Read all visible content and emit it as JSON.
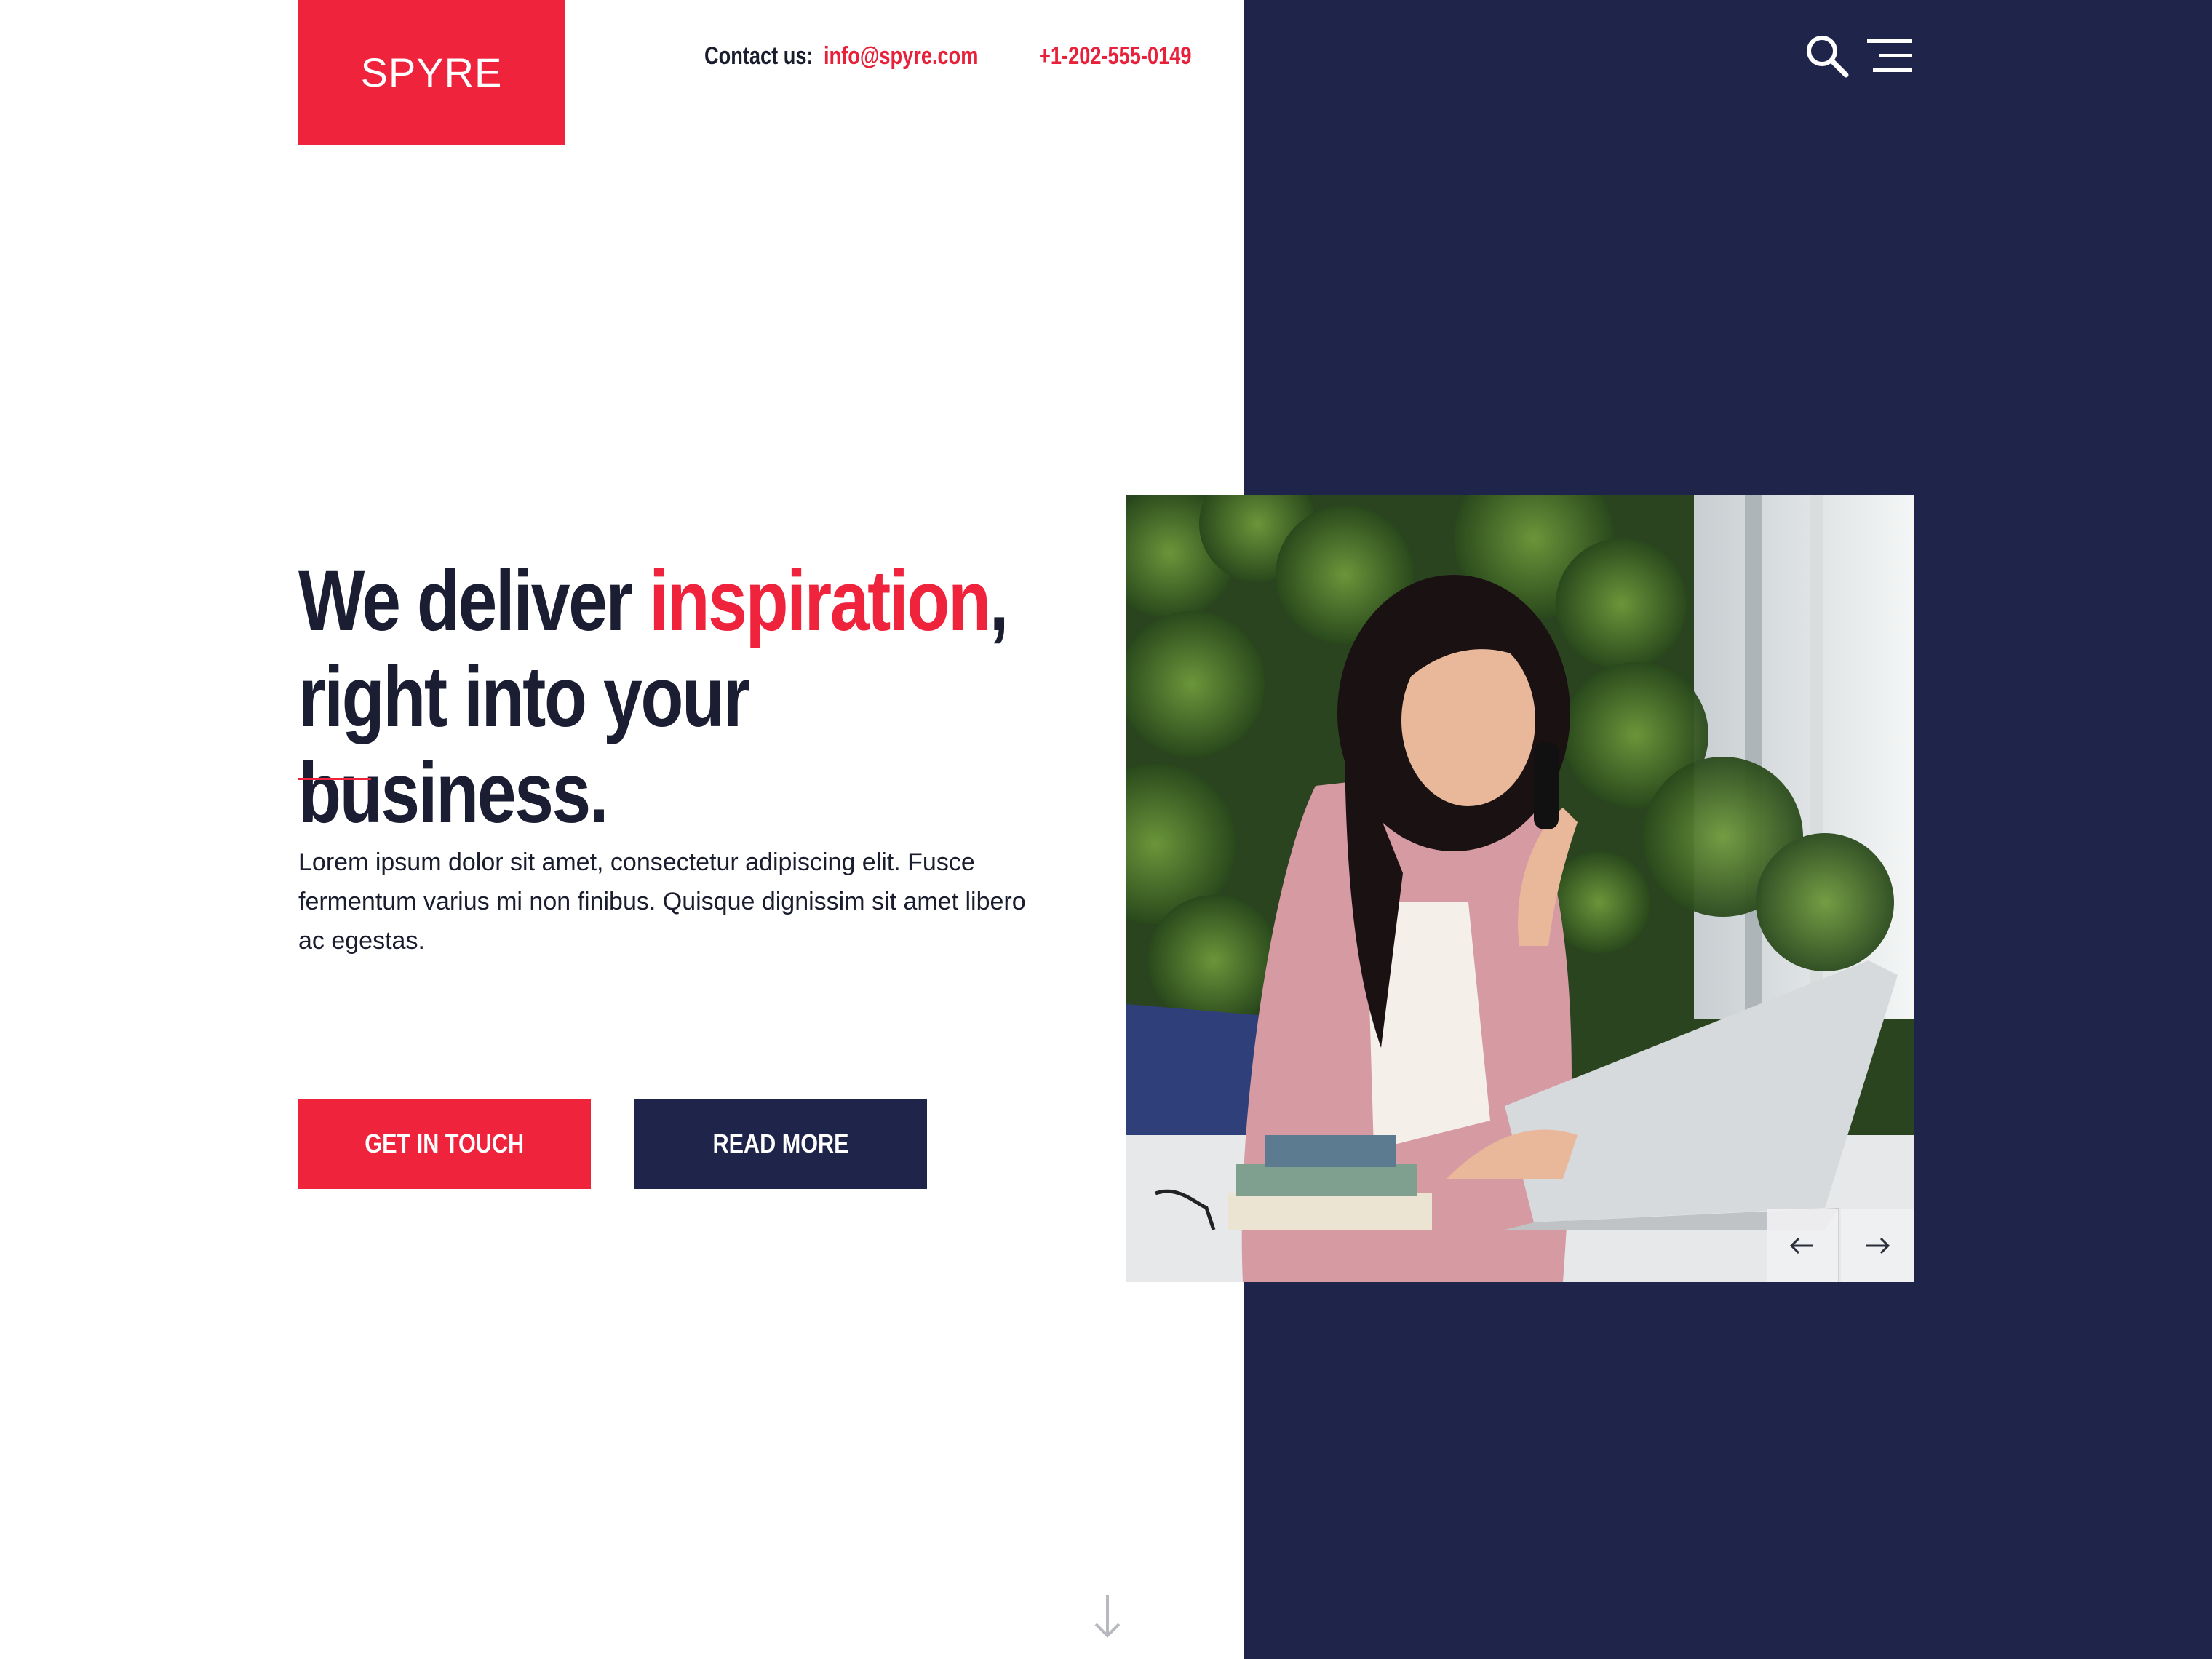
{
  "brand": {
    "logo_text": "SPYRE",
    "accent_color": "#ef233c",
    "panel_color": "#1f244b"
  },
  "header": {
    "contact_label": "Contact us:",
    "email": "info@spyre.com",
    "phone": "+1-202-555-0149",
    "search_icon": "search-icon",
    "menu_icon": "hamburger-menu-icon"
  },
  "hero": {
    "headline_prefix": "We deliver ",
    "headline_accent": "inspiration",
    "headline_comma": ",",
    "headline_line2": "right into your business.",
    "body": "Lorem ipsum dolor sit amet, consectetur adipiscing elit. Fusce fermentum varius mi non finibus. Quisque dignissim sit amet libero ac egestas.",
    "primary_button": "GET IN TOUCH",
    "secondary_button": "READ MORE",
    "image_subject": "woman on phone using laptop",
    "slider_prev_icon": "arrow-left-icon",
    "slider_next_icon": "arrow-right-icon",
    "scroll_icon": "arrow-down-icon"
  }
}
